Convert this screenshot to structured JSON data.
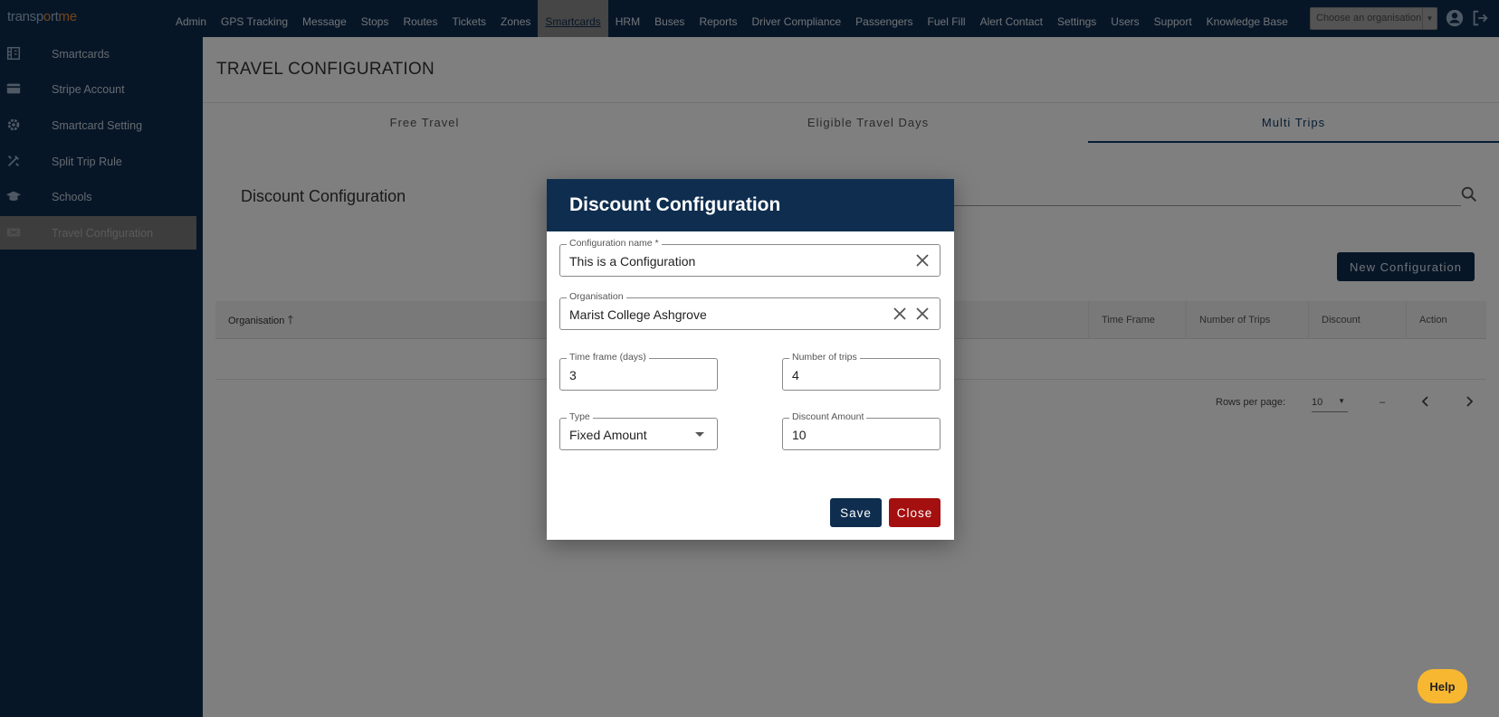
{
  "app": {
    "logo_part1": "transp",
    "logo_part2": "o",
    "logo_part3": "rt",
    "logo_part4": "me"
  },
  "nav": {
    "items": [
      "Admin",
      "GPS Tracking",
      "Message",
      "Stops",
      "Routes",
      "Tickets",
      "Zones",
      "Smartcards",
      "HRM",
      "Buses",
      "Reports",
      "Driver Compliance",
      "Passengers",
      "Fuel Fill",
      "Alert Contact",
      "Settings",
      "Users",
      "Support",
      "Knowledge Base"
    ],
    "active": "Smartcards",
    "org_placeholder": "Choose an organisation"
  },
  "sidebar": {
    "items": [
      {
        "label": "Smartcards",
        "icon": "building-icon"
      },
      {
        "label": "Stripe Account",
        "icon": "credit-card-icon"
      },
      {
        "label": "Smartcard Setting",
        "icon": "gear-icon"
      },
      {
        "label": "Split Trip Rule",
        "icon": "tools-icon"
      },
      {
        "label": "Schools",
        "icon": "graduation-cap-icon"
      },
      {
        "label": "Travel Configuration",
        "icon": "ticket-icon"
      }
    ],
    "active": "Travel Configuration"
  },
  "page": {
    "title": "TRAVEL CONFIGURATION",
    "tabs": [
      "Free Travel",
      "Eligible Travel Days",
      "Multi Trips"
    ],
    "active_tab": "Multi Trips",
    "section_title": "Discount Configuration",
    "new_button": "New Configuration",
    "table": {
      "columns": [
        "Organisation",
        "Time Frame",
        "Number of Trips",
        "Discount",
        "Action"
      ]
    },
    "pager": {
      "rows_label": "Rows per page:",
      "rows_value": "10",
      "range": "–"
    }
  },
  "modal": {
    "title": "Discount Configuration",
    "config_name": {
      "label": "Configuration name *",
      "value": "This is a Configuration"
    },
    "organisation": {
      "label": "Organisation",
      "value": "Marist College Ashgrove"
    },
    "time_frame": {
      "label": "Time frame (days)",
      "value": "3"
    },
    "trips": {
      "label": "Number of trips",
      "value": "4"
    },
    "type": {
      "label": "Type",
      "value": "Fixed Amount"
    },
    "discount": {
      "label": "Discount Amount",
      "value": "10"
    },
    "save": "Save",
    "close": "Close"
  },
  "help": {
    "label": "Help"
  },
  "colors": {
    "primary": "#0e2d4f",
    "danger": "#a40f0f",
    "help": "#f7b731",
    "accent": "#e98a3a"
  }
}
